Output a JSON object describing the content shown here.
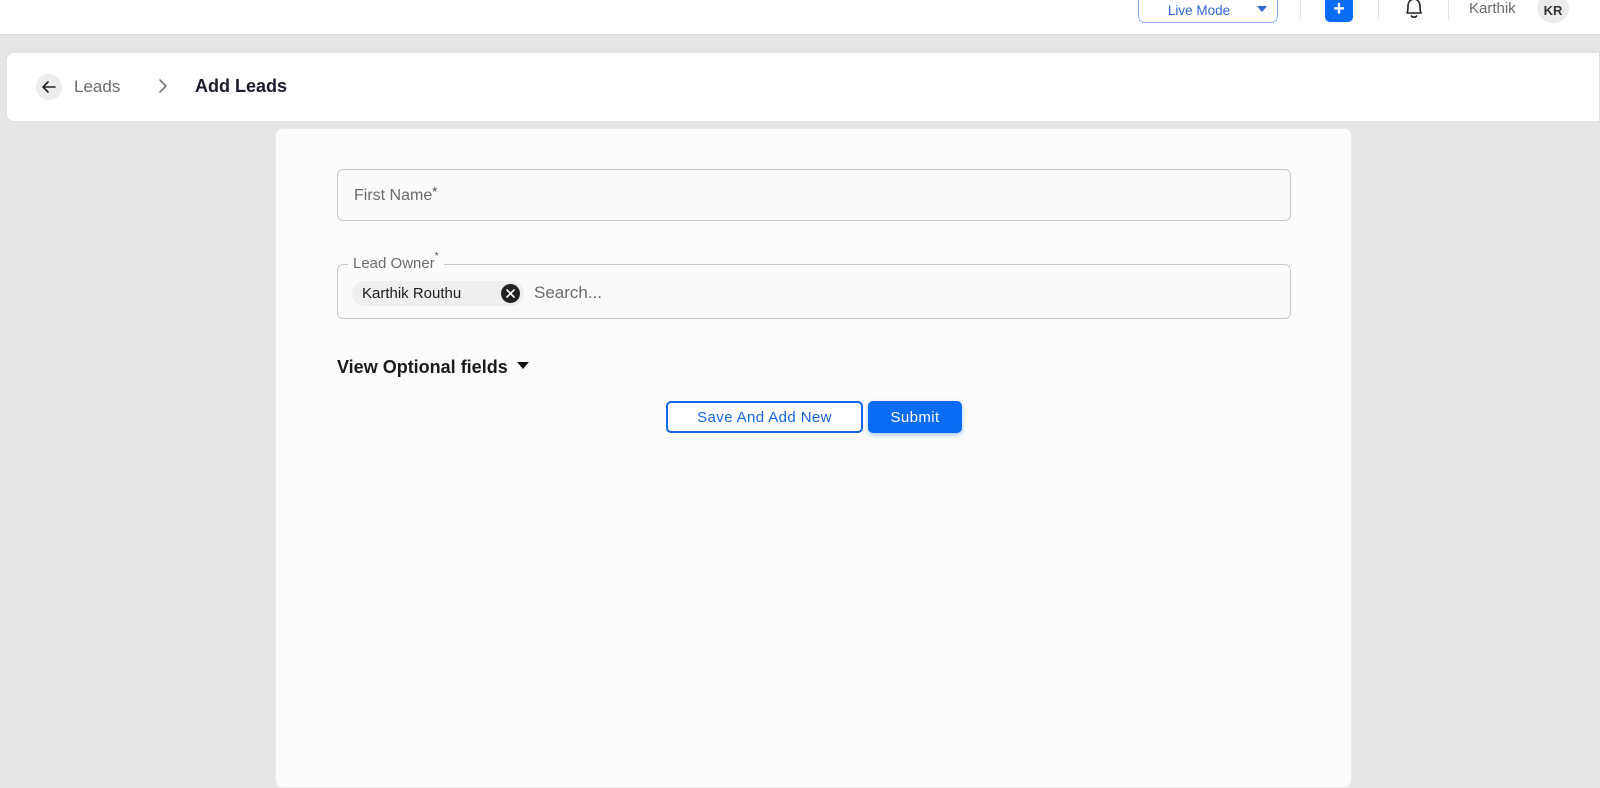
{
  "header": {
    "mode_select": {
      "value": "Live Mode",
      "icon": "chevron-down-icon"
    },
    "add_button": {
      "label": "+",
      "icon": "plus-icon"
    },
    "notifications": {
      "icon": "bell-icon"
    },
    "user": {
      "name": "Karthik",
      "initials": "KR"
    }
  },
  "breadcrumb": {
    "back_icon": "arrow-left-icon",
    "parent": "Leads",
    "separator_icon": "chevron-right-icon",
    "current": "Add Leads"
  },
  "form": {
    "first_name": {
      "placeholder": "First Name",
      "required_mark": "*",
      "value": ""
    },
    "lead_owner": {
      "label": "Lead Owner",
      "required_mark": "*",
      "selected_chips": [
        {
          "label": "Karthik Routhu",
          "remove_icon": "close-circle-icon"
        }
      ],
      "search_placeholder": "Search..."
    },
    "optional_toggle": {
      "label": "View Optional fields",
      "icon": "caret-down-icon"
    },
    "buttons": {
      "save_and_add_new": "Save And Add New",
      "submit": "Submit"
    }
  },
  "colors": {
    "primary": "#0a6cf5",
    "background": "#e5e5e5",
    "card": "#fcfcfc",
    "text_dark": "#1b1b2e",
    "text_muted": "#6b6b6b"
  }
}
